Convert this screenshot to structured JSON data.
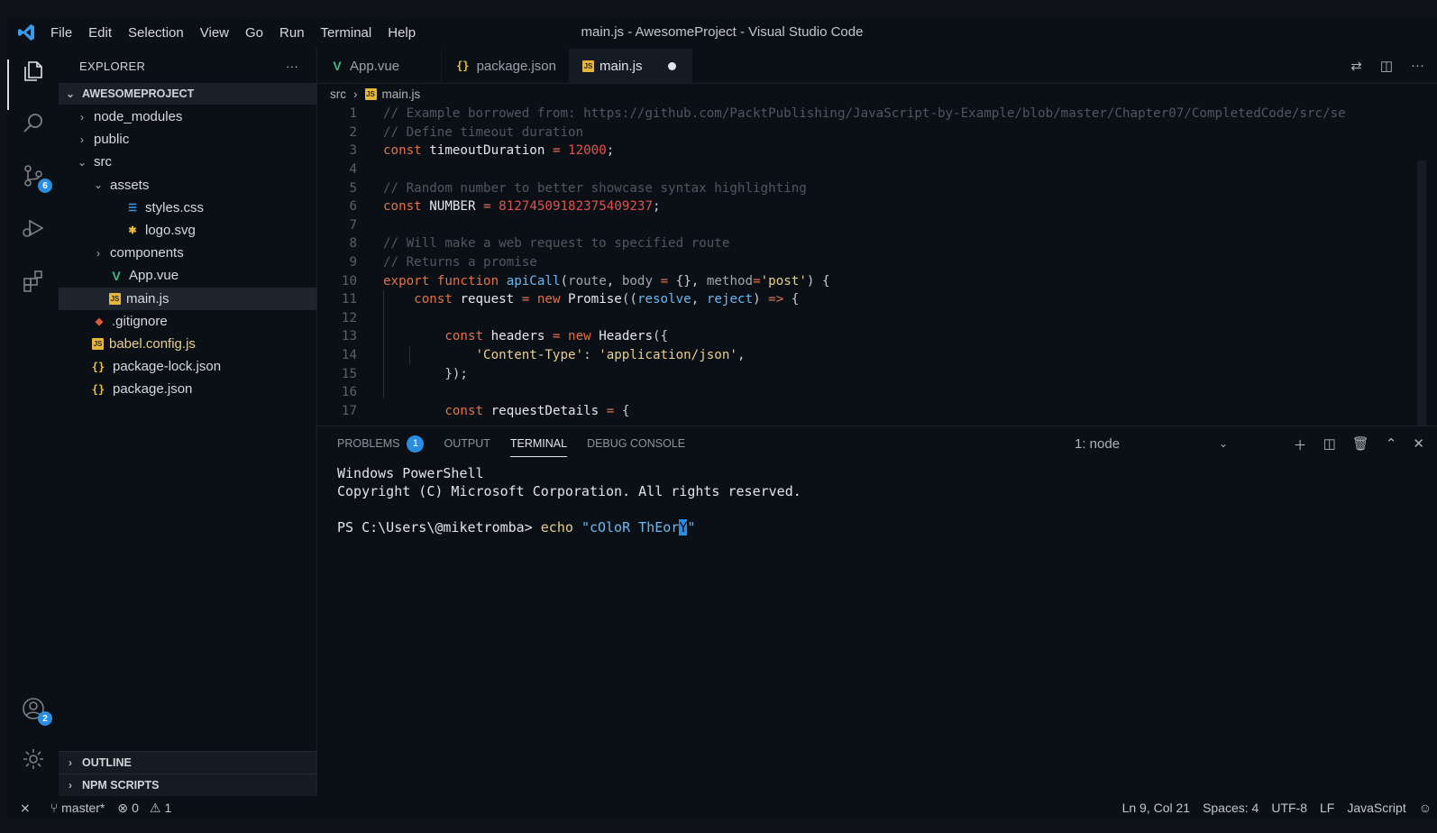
{
  "window": {
    "title": "main.js - AwesomeProject - Visual Studio Code"
  },
  "menu": [
    "File",
    "Edit",
    "Selection",
    "View",
    "Go",
    "Run",
    "Terminal",
    "Help"
  ],
  "activity": {
    "scm_badge": "6",
    "accounts_badge": "2"
  },
  "explorer": {
    "header": "EXPLORER",
    "more": "···",
    "project": "AWESOMEPROJECT",
    "items": [
      {
        "label": "node_modules"
      },
      {
        "label": "public"
      },
      {
        "label": "src"
      },
      {
        "label": "assets"
      },
      {
        "label": "styles.css"
      },
      {
        "label": "logo.svg"
      },
      {
        "label": "components"
      },
      {
        "label": "App.vue"
      },
      {
        "label": "main.js"
      },
      {
        "label": ".gitignore"
      },
      {
        "label": "babel.config.js"
      },
      {
        "label": "package-lock.json"
      },
      {
        "label": "package.json"
      }
    ],
    "outline": "OUTLINE",
    "npm": "NPM SCRIPTS"
  },
  "tabs": [
    {
      "label": "App.vue"
    },
    {
      "label": "package.json"
    },
    {
      "label": "main.js"
    }
  ],
  "breadcrumb": {
    "folder": "src",
    "file": "main.js"
  },
  "code": {
    "l1": "// Example borrowed from: https://github.com/PacktPublishing/JavaScript-by-Example/blob/master/Chapter07/CompletedCode/src/se",
    "l2": "// Define timeout duration",
    "l5": "// Random number to better showcase syntax highlighting",
    "l8": "// Will make a web request to specified route",
    "l9": "// Returns a promise",
    "const": "const",
    "export": "export",
    "function": "function",
    "new": "new",
    "timeoutDuration": "timeoutDuration",
    "timeoutVal": "12000",
    "NUMBER": "NUMBER",
    "numberVal": "81274509182375409237",
    "apiCall": "apiCall",
    "route": "route",
    "body": "body",
    "method": "method",
    "post": "'post'",
    "request": "request",
    "Promise": "Promise",
    "resolve": "resolve",
    "reject": "reject",
    "headers": "headers",
    "Headers": "Headers",
    "ctKey": "'Content-Type'",
    "ctVal": "'application/json'",
    "requestDetails": "requestDetails"
  },
  "panel": {
    "tabs": [
      "PROBLEMS",
      "OUTPUT",
      "TERMINAL",
      "DEBUG CONSOLE"
    ],
    "problems_count": "1",
    "terminal_select": "1: node",
    "lines": [
      "Windows PowerShell",
      "Copyright (C) Microsoft Corporation. All rights reserved."
    ],
    "prompt": "PS C:\\Users\\@miketromba> ",
    "cmd": "echo",
    "arg_before": "\"cOloR ThEor",
    "arg_cursor": "Y",
    "arg_after": "\""
  },
  "status": {
    "branch": "master*",
    "errors": "0",
    "warnings": "1",
    "position": "Ln 9, Col 21",
    "spaces": "Spaces: 4",
    "encoding": "UTF-8",
    "eol": "LF",
    "language": "JavaScript"
  },
  "colors": {
    "accent": "#2a8de0",
    "keyword": "#e0724a",
    "string": "#e8cf8c",
    "number": "#e05252",
    "function": "#6db8ef"
  }
}
